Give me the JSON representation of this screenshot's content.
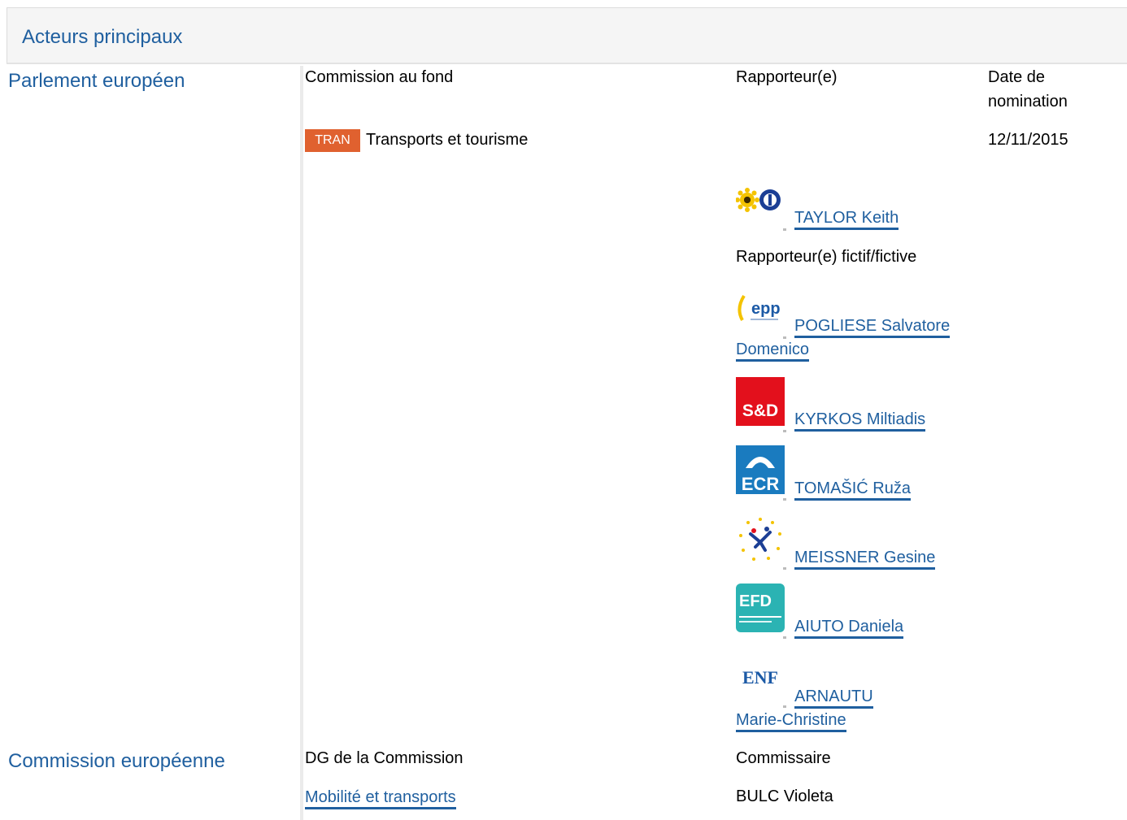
{
  "section": {
    "title": "Acteurs principaux"
  },
  "parliament": {
    "label": "Parlement européen",
    "col_committee_header": "Commission au fond",
    "col_rapporteur_header": "Rapporteur(e)",
    "col_date_header_line1": "Date de",
    "col_date_header_line2": "nomination",
    "committee_badge": "TRAN",
    "committee_name": "Transports et tourisme",
    "appointment_date": "12/11/2015",
    "rapporteur": {
      "name": "TAYLOR Keith",
      "group_logo": "greens-efa-logo"
    },
    "shadow_label": "Rapporteur(e) fictif/fictive",
    "shadows": [
      {
        "name_line1": "POGLIESE Salvatore",
        "name_line2": "Domenico",
        "group_logo": "epp-logo",
        "logo_text": "epp"
      },
      {
        "name_line1": "KYRKOS Miltiadis",
        "group_logo": "s-and-d-logo",
        "logo_text": "S&D"
      },
      {
        "name_line1": "TOMAŠIĆ Ruža",
        "group_logo": "ecr-logo",
        "logo_text": "ECR"
      },
      {
        "name_line1": "MEISSNER Gesine",
        "group_logo": "alde-logo"
      },
      {
        "name_line1": "AIUTO Daniela",
        "group_logo": "efdd-logo",
        "logo_text": "EFD"
      },
      {
        "name_line1": "ARNAUTU",
        "name_line2": "Marie-Christine",
        "group_logo": "enf-logo",
        "logo_text": "ENF"
      }
    ]
  },
  "commission": {
    "label": "Commission européenne",
    "col_dg_header": "DG de la Commission",
    "col_commissioner_header": "Commissaire",
    "dg_name": "Mobilité et transports",
    "commissioner": "BULC Violeta"
  },
  "colors": {
    "link": "#1f5f9f",
    "badge": "#e0612f",
    "s_and_d": "#e3101c",
    "ecr": "#1a7bbf",
    "efdd": "#2bb3b3"
  }
}
